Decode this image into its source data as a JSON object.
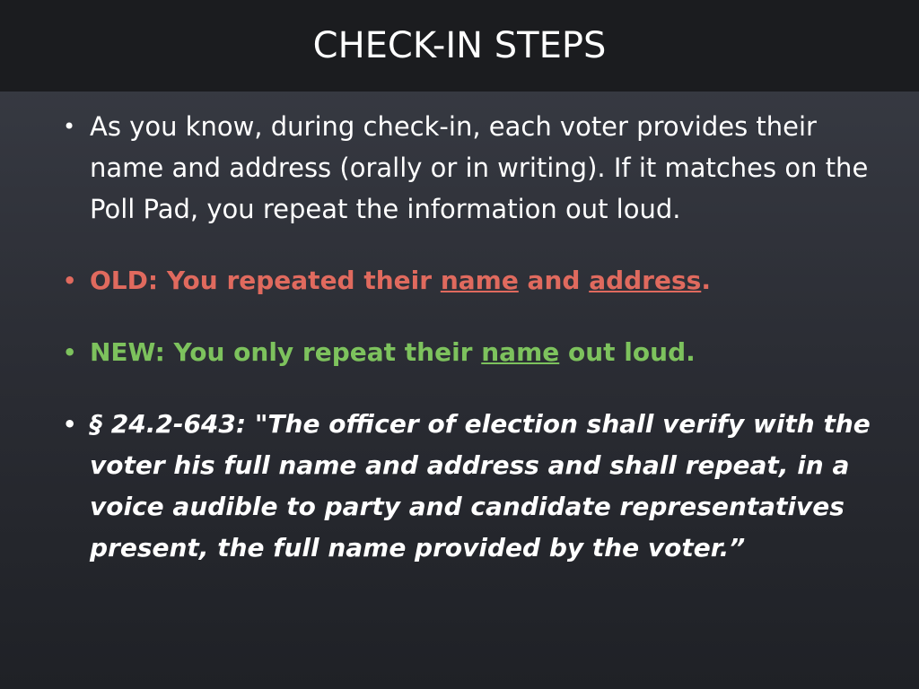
{
  "slide": {
    "title": "CHECK-IN STEPS",
    "bullet_glyph": "•",
    "bullet1": {
      "text": "As you know, during check-in, each voter provides their name and address (orally or in writing). If it matches on the Poll Pad, you repeat the information out loud."
    },
    "bullet2": {
      "prefix": "OLD: You repeated their ",
      "u1": "name",
      "mid": " and ",
      "u2": "address",
      "suffix": ".",
      "color": "#e06a5e"
    },
    "bullet3": {
      "prefix": "NEW: You only repeat their ",
      "u1": "name",
      "suffix": " out loud.",
      "color": "#7dc25d"
    },
    "bullet4": {
      "text": "§ 24.2-643: \"The officer of election shall verify with the voter his full name and address and shall repeat, in a voice audible to party and candidate representatives present, the full name provided by the voter.”"
    }
  }
}
